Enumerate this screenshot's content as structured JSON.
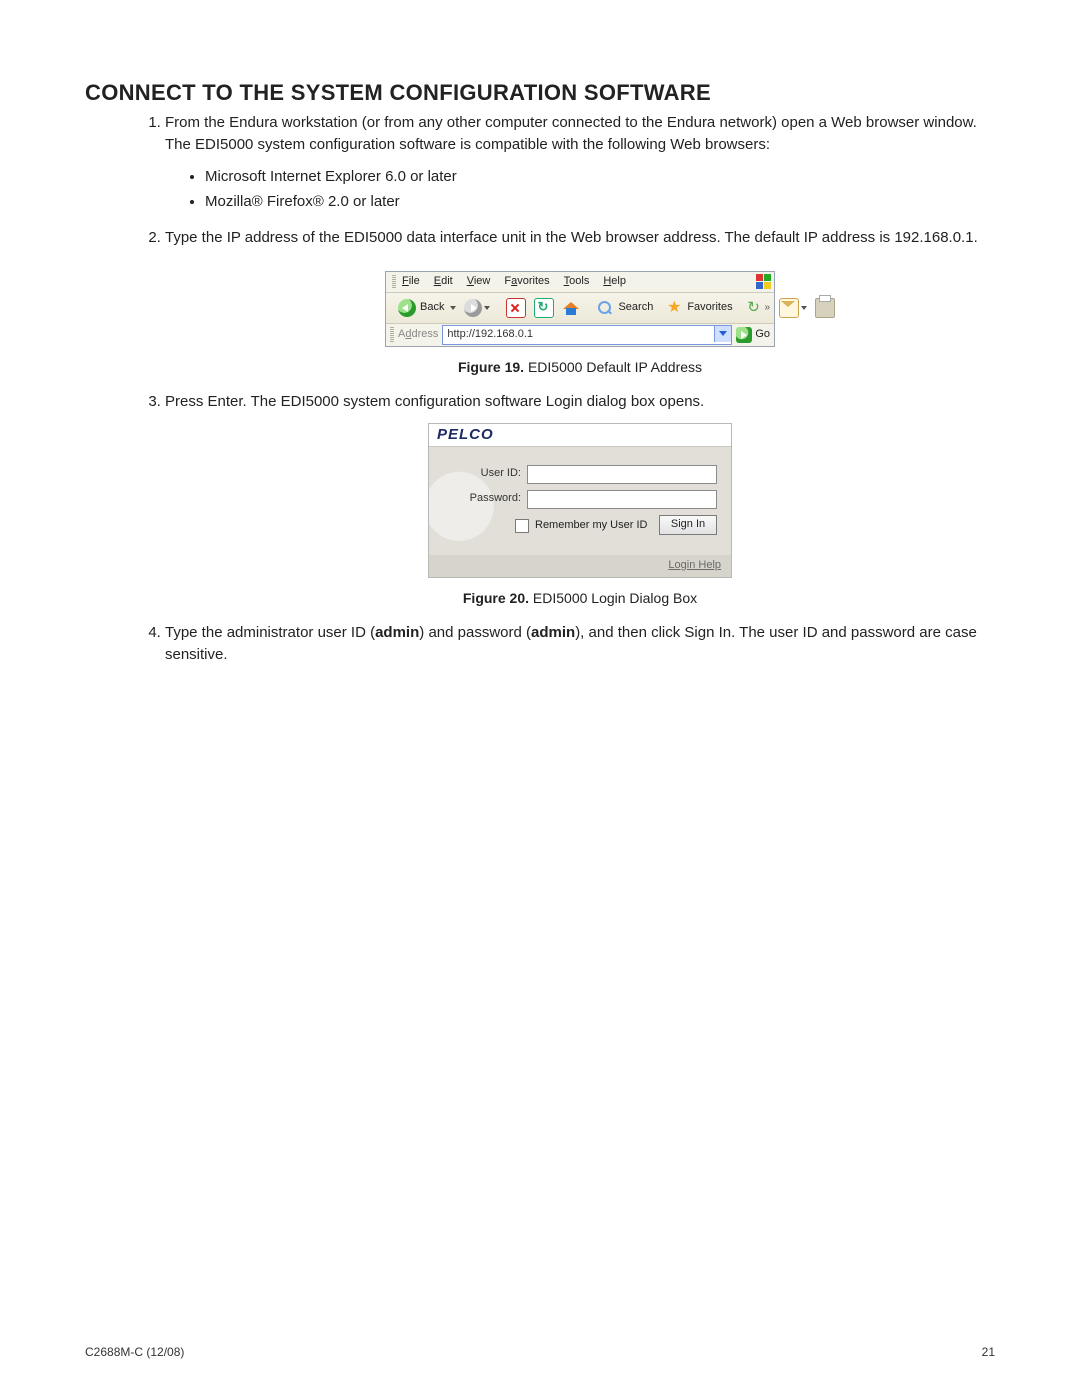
{
  "heading": "Connect to the System Configuration Software",
  "steps": {
    "s1": "From the Endura workstation (or from any other computer connected to the Endura network) open a Web browser window. The EDI5000 system configuration software is compatible with the following Web browsers:",
    "s1_bullets": [
      "Microsoft Internet Explorer 6.0 or later",
      "Mozilla® Firefox® 2.0 or later"
    ],
    "s2": "Type the IP address of the EDI5000 data interface unit in the Web browser address. The default IP address is 192.168.0.1.",
    "s3": "Press Enter. The EDI5000 system configuration software Login dialog box opens.",
    "s4_pre": "Type the administrator user ID (",
    "s4_b1": "admin",
    "s4_mid": ") and password (",
    "s4_b2": "admin",
    "s4_post": "), and then click Sign In. The user ID and password are case sensitive."
  },
  "fig19": {
    "caption_b": "Figure 19.",
    "caption_t": "  EDI5000 Default IP Address",
    "menu": {
      "file": "File",
      "edit": "Edit",
      "view": "View",
      "fav": "Favorites",
      "tools": "Tools",
      "help": "Help"
    },
    "back": "Back",
    "search": "Search",
    "favorites": "Favorites",
    "address_label": "Address",
    "url": "http://192.168.0.1",
    "go": "Go"
  },
  "fig20": {
    "caption_b": "Figure 20.",
    "caption_t": "  EDI5000 Login Dialog Box",
    "brand": "PELCO",
    "user_label": "User ID:",
    "pass_label": "Password:",
    "remember": "Remember my User ID",
    "signin": "Sign In",
    "loginhelp": "Login Help"
  },
  "footer": {
    "left": "C2688M-C (12/08)",
    "right": "21"
  }
}
